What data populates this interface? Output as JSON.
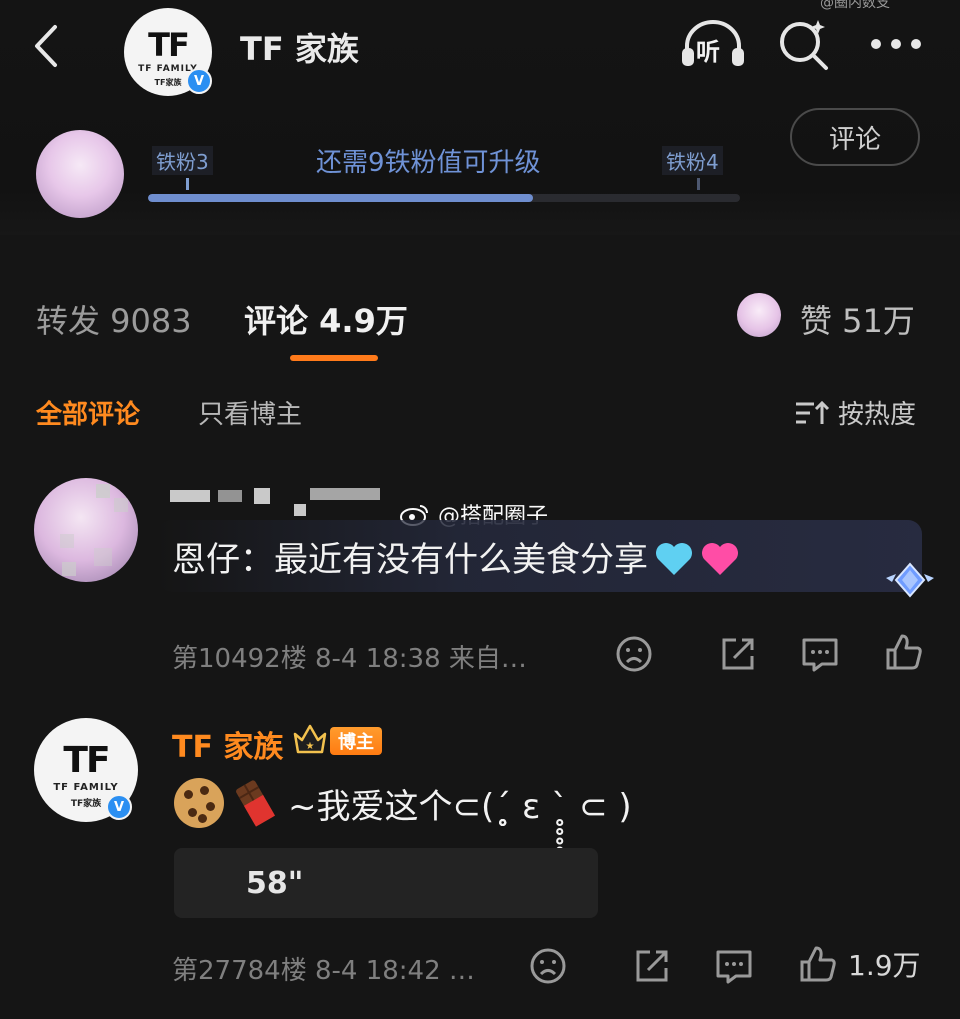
{
  "header": {
    "channel_name": "TF 家族",
    "logo_mark": "TF",
    "logo_sub": "TF FAMILY",
    "logo_sub_cn": "TF家族",
    "listen_label": "听",
    "watermark_top": "@圈内数支"
  },
  "fan_level": {
    "current": "铁粉3",
    "next": "铁粉4",
    "message": "还需9铁粉值可升级",
    "progress_percent": 65,
    "comment_button": "评论"
  },
  "stats_tabs": {
    "repost": "转发 9083",
    "comments": "评论 4.9万",
    "likes": "赞 51万"
  },
  "filters": {
    "all": "全部评论",
    "host_only": "只看博主",
    "sort": "按热度"
  },
  "watermark": "@搭配圈子",
  "comments": [
    {
      "author": "",
      "text": "恩仔：最近有没有什么美食分享",
      "meta": "第10492楼 8-4 18:38 来自…",
      "like_count": ""
    },
    {
      "author": "TF 家族",
      "badge": "博主",
      "text": "~我爱这个⊂(ˊ̥̥̥̥̥ ε ˋ̥̥̥̥̥ ⊂ )",
      "voice": "58\"",
      "meta": "第27784楼 8-4 18:42 …",
      "like_count": "1.9万"
    }
  ],
  "colors": {
    "background": "#151515",
    "accent_orange": "#ff8a1f",
    "fan_blue": "#6f92d6",
    "verify_blue": "#2b8ff2"
  }
}
